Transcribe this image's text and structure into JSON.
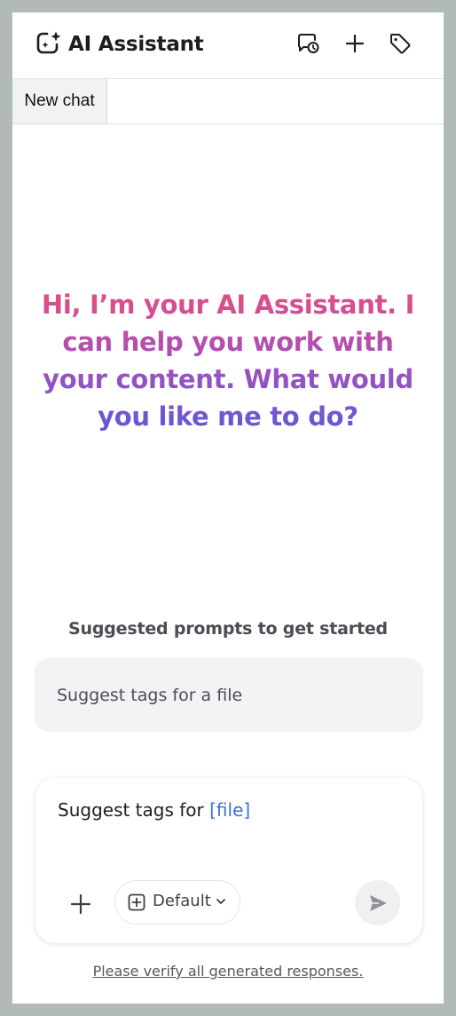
{
  "header": {
    "title": "AI Assistant",
    "icons": {
      "logo": "sparkle-chat-icon",
      "history": "chat-history-icon",
      "new_chat": "plus-icon",
      "tag": "tag-icon"
    }
  },
  "tabs": [
    {
      "label": "New chat",
      "active": true
    }
  ],
  "greeting": {
    "text": "Hi, I’m your AI Assistant. I can help you work with your content. What would you like me to do?",
    "gradient": [
      "#e84f7c",
      "#b24fb0",
      "#8a53c8",
      "#5f58d6"
    ]
  },
  "suggestions": {
    "heading": "Suggested prompts to get started",
    "items": [
      {
        "label": "Suggest tags for a file"
      }
    ]
  },
  "composer": {
    "text_prefix": "Suggest tags for ",
    "variable": "[file]",
    "add_icon": "plus-icon",
    "mode": {
      "icon": "plus-square-icon",
      "label": "Default",
      "chevron": "chevron-down-icon"
    },
    "send_icon": "send-icon"
  },
  "footer": {
    "disclaimer": "Please verify all generated responses."
  },
  "colors": {
    "background": "#b2bab9",
    "panel": "#ffffff",
    "variable": "#3b6fd6",
    "card": "#f2f3f5"
  }
}
